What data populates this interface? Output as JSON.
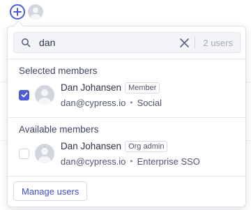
{
  "topbar": {
    "add_icon": "plus-circle-icon",
    "avatar_icon": "user-avatar-icon"
  },
  "search": {
    "value": "dan",
    "placeholder": "",
    "count_label": "2 users"
  },
  "sections": {
    "selected_title": "Selected members",
    "available_title": "Available members"
  },
  "selected_members": [
    {
      "name": "Dan Johansen",
      "role": "Member",
      "email": "dan@cypress.io",
      "dot": "•",
      "auth": "Social",
      "checked": true
    }
  ],
  "available_members": [
    {
      "name": "Dan Johansen",
      "role": "Org admin",
      "email": "dan@cypress.io",
      "dot": "•",
      "auth": "Enterprise SSO",
      "checked": false
    }
  ],
  "footer": {
    "manage_label": "Manage users"
  },
  "colors": {
    "accent": "#4b5cd6",
    "text": "#2e3247",
    "muted": "#a7abb8"
  }
}
